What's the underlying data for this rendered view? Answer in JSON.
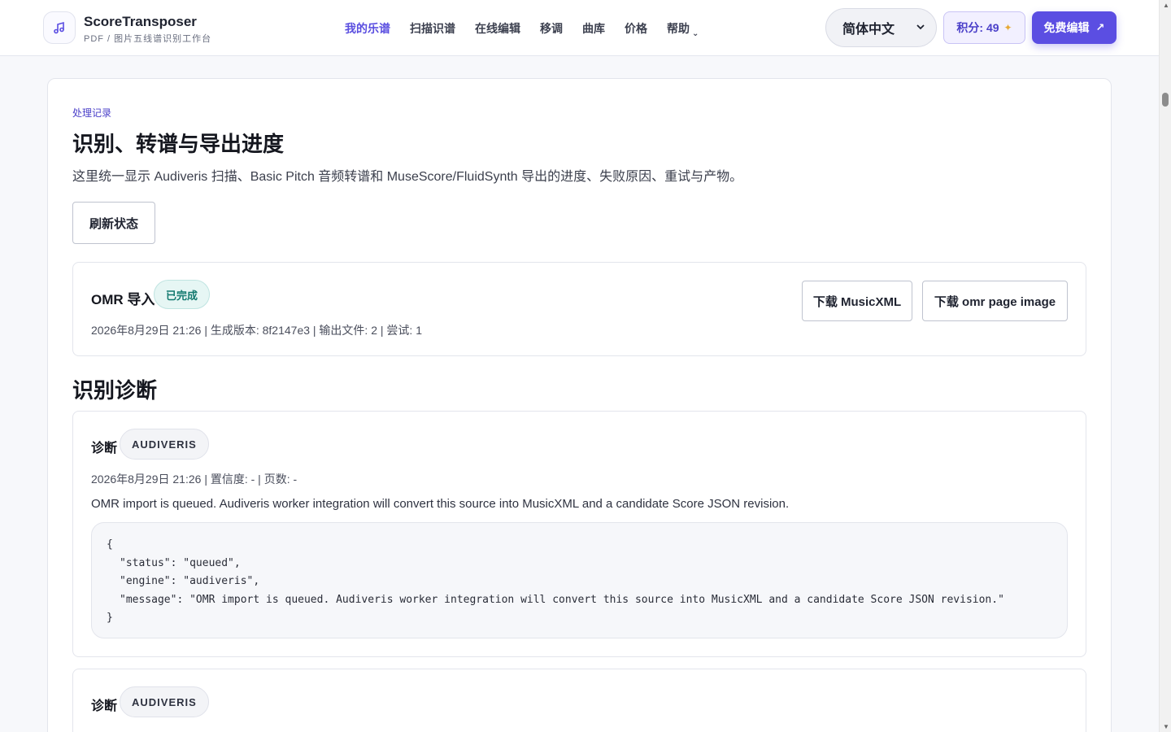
{
  "header": {
    "brand_name": "ScoreTransposer",
    "brand_sub": "PDF / 图片五线谱识别工作台",
    "nav": [
      {
        "label": "我的乐谱",
        "active": true
      },
      {
        "label": "扫描识谱",
        "active": false
      },
      {
        "label": "在线编辑",
        "active": false
      },
      {
        "label": "移调",
        "active": false
      },
      {
        "label": "曲库",
        "active": false
      },
      {
        "label": "价格",
        "active": false
      },
      {
        "label": "帮助",
        "active": false
      }
    ],
    "language": "简体中文",
    "points": "积分: 49",
    "free_edit": "免费编辑"
  },
  "main": {
    "eyebrow": "处理记录",
    "title": "识别、转谱与导出进度",
    "description": "这里统一显示 Audiveris 扫描、Basic Pitch 音频转谱和 MuseScore/FluidSynth 导出的进度、失败原因、重试与产物。",
    "refresh_label": "刷新状态",
    "job": {
      "title": "OMR 导入",
      "status": "已完成",
      "meta": "2026年8月29日 21:26 | 生成版本: 8f2147e3 | 输出文件: 2 | 尝试: 1",
      "download_xml": "下载 MusicXML",
      "download_image": "下载 omr page image"
    },
    "diagnostics_title": "识别诊断",
    "diagnostics": [
      {
        "title": "诊断",
        "engine": "AUDIVERIS",
        "meta": "2026年8月29日 21:26 | 置信度: - | 页数: -",
        "message": "OMR import is queued. Audiveris worker integration will convert this source into MusicXML and a candidate Score JSON revision.",
        "code": {
          "open": "{",
          "line1": "\"status\": \"queued\",",
          "line2": "\"engine\": \"audiveris\",",
          "line3": "\"message\": \"OMR import is queued. Audiveris worker integration will convert this source into MusicXML and a candidate Score JSON revision.\"",
          "close": "}"
        }
      },
      {
        "title": "诊断",
        "engine": "AUDIVERIS"
      }
    ]
  },
  "colors": {
    "accent": "#5b4ee2",
    "success": "#137a6f",
    "warning_spark": "#e7a934"
  }
}
